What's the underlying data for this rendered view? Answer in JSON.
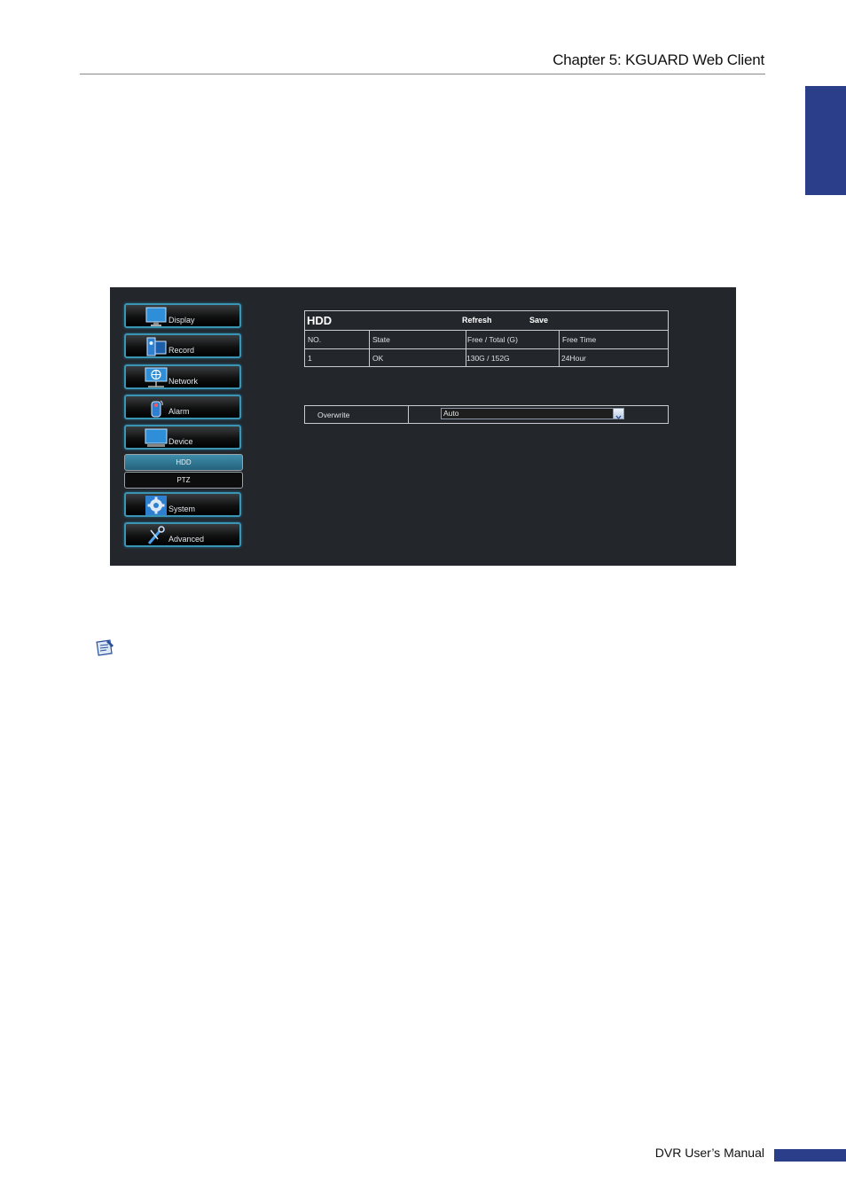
{
  "page": {
    "header_title": "Chapter 5: KGUARD Web Client",
    "footer_title": "DVR User’s Manual"
  },
  "colors": {
    "accent_blue": "#2b3e8a",
    "app_background": "#23262b",
    "menu_border": "#3a95b5"
  },
  "menu": {
    "items": [
      {
        "label": "Display",
        "icon": "monitor-icon"
      },
      {
        "label": "Record",
        "icon": "record-icon"
      },
      {
        "label": "Network",
        "icon": "network-globe-icon"
      },
      {
        "label": "Alarm",
        "icon": "alarm-icon"
      },
      {
        "label": "Device",
        "icon": "device-monitor-icon"
      },
      {
        "label": "System",
        "icon": "gear-icon"
      },
      {
        "label": "Advanced",
        "icon": "tools-icon"
      }
    ],
    "submenu": [
      {
        "label": "HDD",
        "selected": true
      },
      {
        "label": "PTZ",
        "selected": false
      }
    ]
  },
  "hdd": {
    "title": "HDD",
    "refresh_label": "Refresh",
    "save_label": "Save",
    "columns": [
      "NO.",
      "State",
      "Free / Total (G)",
      "Free Time"
    ],
    "rows": [
      [
        "1",
        "OK",
        "130G / 152G",
        "24Hour"
      ]
    ]
  },
  "overwrite": {
    "label": "Overwrite",
    "value": "Auto"
  }
}
